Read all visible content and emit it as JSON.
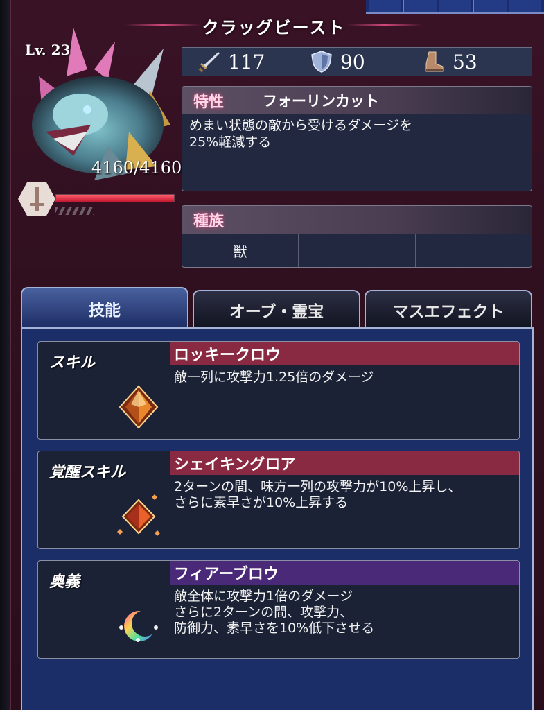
{
  "unit": {
    "name": "クラッグビースト",
    "level": "Lv. 23",
    "hp": "4160/4160",
    "hp_fraction": 1.0
  },
  "stats": [
    {
      "icon": "sword-icon",
      "value": "117"
    },
    {
      "icon": "shield-icon",
      "value": "90"
    },
    {
      "icon": "boot-icon",
      "value": "53"
    }
  ],
  "trait": {
    "header": "特性",
    "name": "フォーリンカット",
    "description": "めまい状態の敵から受けるダメージを\n25%軽減する"
  },
  "race": {
    "header": "種族",
    "cells": [
      "獣",
      "",
      ""
    ]
  },
  "tabs": [
    {
      "label": "技能",
      "active": true
    },
    {
      "label": "オーブ・霊宝",
      "active": false
    },
    {
      "label": "マスエフェクト",
      "active": false
    }
  ],
  "skills": [
    {
      "type": "スキル",
      "name": "ロッキークロウ",
      "description": "敵一列に攻撃力1.25倍のダメージ",
      "name_color": "#8a2a42",
      "icon": "orange-crystal-icon"
    },
    {
      "type": "覚醒スキル",
      "name": "シェイキングロア",
      "description": "2ターンの間、味方一列の攻撃力が10%上昇し、\nさらに素早さが10%上昇する",
      "name_color": "#8a2a42",
      "icon": "orange-crystal-burst-icon"
    },
    {
      "type": "奥義",
      "name": "フィアーブロウ",
      "description": "敵全体に攻撃力1倍のダメージ\nさらに2ターンの間、攻撃力、\n防御力、素早さを10%低下させる",
      "name_color": "#4a2a78",
      "icon": "crescent-moon-icon"
    }
  ]
}
